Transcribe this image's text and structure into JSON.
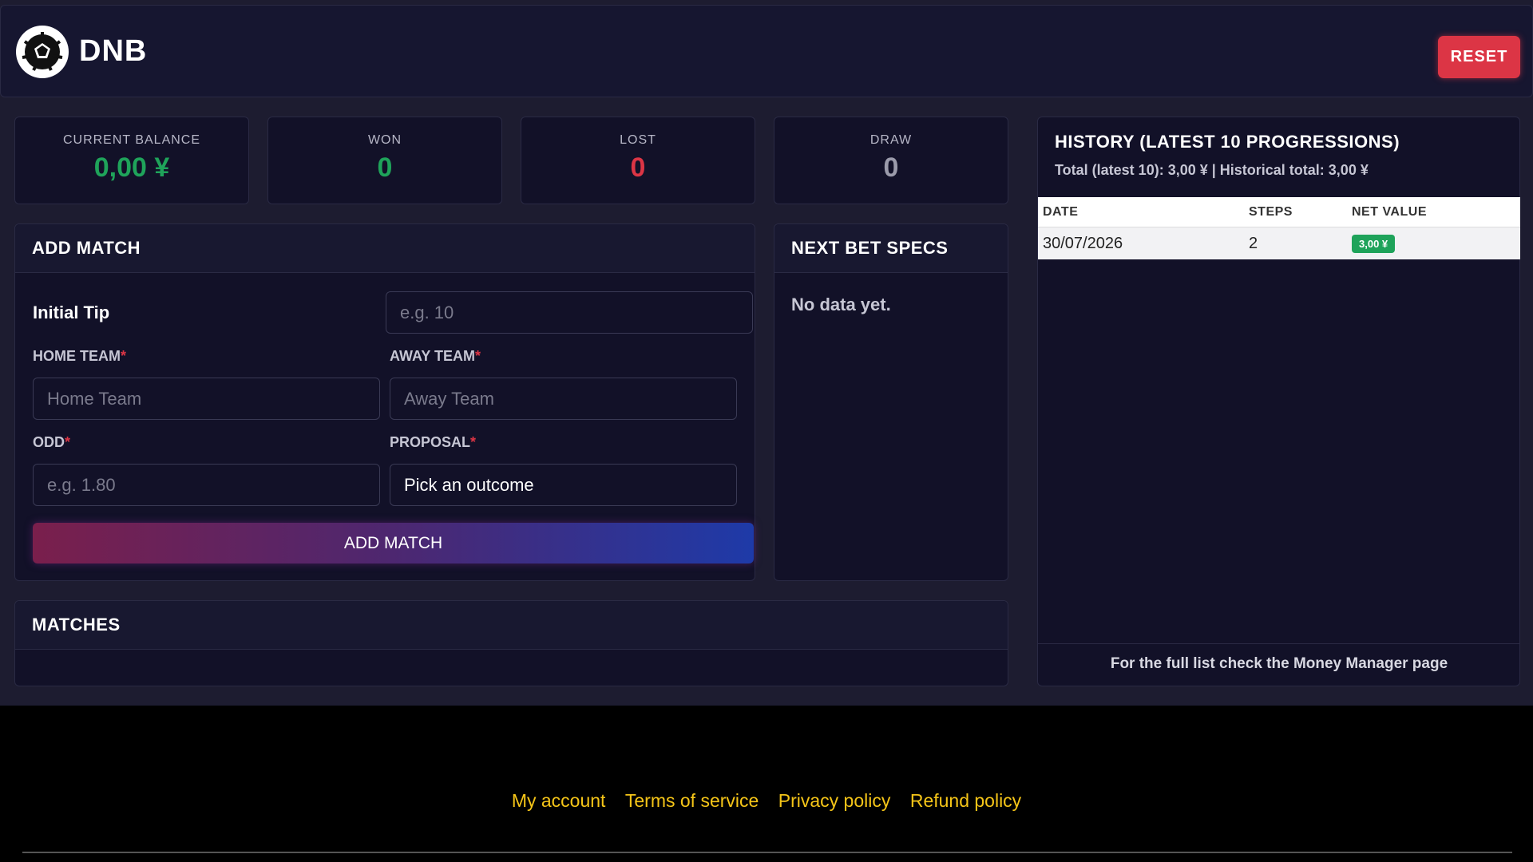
{
  "header": {
    "brand": "DNB",
    "reset_label": "RESET"
  },
  "stats": {
    "balance": {
      "label": "CURRENT BALANCE",
      "value": "0,00 ¥"
    },
    "won": {
      "label": "WON",
      "value": "0"
    },
    "lost": {
      "label": "LOST",
      "value": "0"
    },
    "draw": {
      "label": "DRAW",
      "value": "0"
    }
  },
  "add_match": {
    "title": "ADD MATCH",
    "initial_tip_label": "Initial Tip",
    "initial_tip_placeholder": "e.g. 10",
    "home_label": "HOME TEAM",
    "home_placeholder": "Home Team",
    "away_label": "AWAY TEAM",
    "away_placeholder": "Away Team",
    "odd_label": "ODD",
    "odd_placeholder": "e.g. 1.80",
    "proposal_label": "PROPOSAL",
    "proposal_value": "Pick an outcome",
    "required_mark": "*",
    "button_label": "ADD MATCH"
  },
  "next_bet": {
    "title": "NEXT BET SPECS",
    "empty_text": "No data yet."
  },
  "matches": {
    "title": "MATCHES"
  },
  "history": {
    "title": "HISTORY (LATEST 10 PROGRESSIONS)",
    "subtitle": "Total (latest 10): 3,00 ¥ | Historical total: 3,00 ¥",
    "columns": [
      "DATE",
      "STEPS",
      "NET VALUE"
    ],
    "rows": [
      {
        "date": "30/07/2026",
        "steps": "2",
        "net": "3,00 ¥"
      }
    ],
    "footer": "For the full list check the Money Manager page"
  },
  "footer": {
    "links": [
      "My account",
      "Terms of service",
      "Privacy policy",
      "Refund policy"
    ]
  },
  "colors": {
    "accent_red": "#dc3545",
    "accent_green": "#1fa35a",
    "link_yellow": "#f5c518"
  },
  "icons": {
    "logo": "soccer-ball-icon"
  }
}
